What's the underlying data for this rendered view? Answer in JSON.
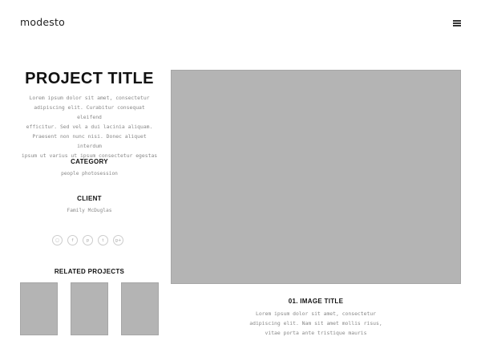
{
  "header": {
    "logo": "modesto",
    "menu_icon": "hamburger-menu-icon"
  },
  "project": {
    "title": "PROJECT TITLE",
    "description": [
      "Lorem ipsum dolor sit amet, consectetur",
      "adipiscing elit. Curabitur consequat eleifend",
      "efficitur. Sed vel a dui lacinia aliquam.",
      "Praesent non nunc nisi. Donec aliquet interdum",
      "ipsum ut varius ut ipsum consectetur egestas"
    ],
    "category_heading": "CATEGORY",
    "category_value": "people photosession",
    "client_heading": "CLIENT",
    "client_value": "Family McDuglas"
  },
  "socials": [
    {
      "name": "instagram-icon",
      "glyph": "◻"
    },
    {
      "name": "facebook-icon",
      "glyph": "f"
    },
    {
      "name": "pinterest-icon",
      "glyph": "p"
    },
    {
      "name": "twitter-icon",
      "glyph": "t"
    },
    {
      "name": "google-plus-icon",
      "glyph": "g+"
    }
  ],
  "related": {
    "heading": "RELATED PROJECTS",
    "count": 3
  },
  "gallery": {
    "image_title": "01. IMAGE TITLE",
    "caption": [
      "Lorem ipsum dolor sit amet, consectetur",
      "adipiscing elit. Nam sit amet mollis risus,",
      "vitae porta ante tristique mauris"
    ]
  },
  "colors": {
    "placeholder": "#b4b4b4",
    "text_dark": "#111111",
    "text_muted": "#888888"
  }
}
